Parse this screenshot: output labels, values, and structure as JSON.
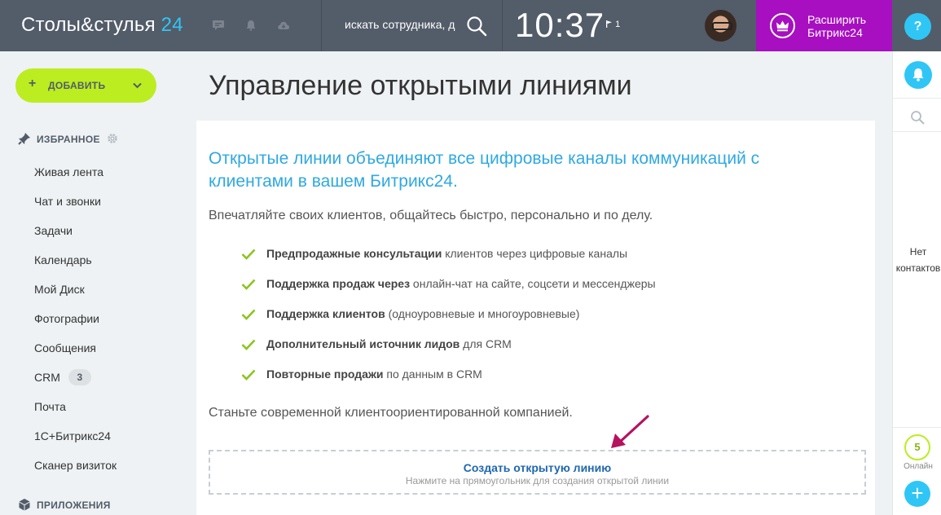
{
  "header": {
    "logo_name": "Столы&стулья",
    "logo_num": "24",
    "search_placeholder": "искать сотрудника, д",
    "clock": "10:37",
    "flag_count": "1",
    "upgrade_line1": "Расширить",
    "upgrade_line2": "Битрикс24",
    "help": "?"
  },
  "sidebar": {
    "add_label": "ДОБАВИТЬ",
    "add_plus": "+",
    "favorites": "ИЗБРАННОЕ",
    "items": [
      {
        "label": "Живая лента"
      },
      {
        "label": "Чат и звонки"
      },
      {
        "label": "Задачи"
      },
      {
        "label": "Календарь"
      },
      {
        "label": "Мой Диск"
      },
      {
        "label": "Фотографии"
      },
      {
        "label": "Сообщения"
      },
      {
        "label": "CRM",
        "badge": "3"
      },
      {
        "label": "Почта"
      },
      {
        "label": "1С+Битрикс24"
      },
      {
        "label": "Сканер визиток"
      }
    ],
    "apps": "ПРИЛОЖЕНИЯ"
  },
  "main": {
    "title": "Управление открытыми линиями",
    "lead": "Открытые линии объединяют все цифровые каналы коммуникаций с клиентами в вашем Битрикс24.",
    "sub": "Впечатляйте своих клиентов, общайтесь быстро, персонально и по делу.",
    "features": [
      {
        "bold": "Предпродажные консультации",
        "rest": " клиентов через цифровые каналы"
      },
      {
        "bold": "Поддержка продаж через",
        "rest": " онлайн-чат на сайте, соцсети и мессенджеры"
      },
      {
        "bold": "Поддержка клиентов",
        "rest": " (одноуровневые и многоуровневые)"
      },
      {
        "bold": "Дополнительный источник лидов",
        "rest": " для CRM"
      },
      {
        "bold": "Повторные продажи",
        "rest": " по данным в CRM"
      }
    ],
    "footer": "Станьте современной клиентоориентированной компанией.",
    "create_title": "Создать открытую линию",
    "create_sub": "Нажмите на прямоугольник для создания открытой линии"
  },
  "right_panel": {
    "no_contacts_1": "Нет",
    "no_contacts_2": "контактов",
    "online_count": "5",
    "online_label": "Онлайн",
    "plus": "+"
  },
  "colors": {
    "header_bg": "#535c69",
    "accent_blue": "#2fc6f6",
    "upgrade_purple": "#a70fc0",
    "add_green": "#bbed21",
    "lead_blue": "#2fa9e1",
    "link_blue": "#1f67b0",
    "arrow": "#b5125f"
  }
}
